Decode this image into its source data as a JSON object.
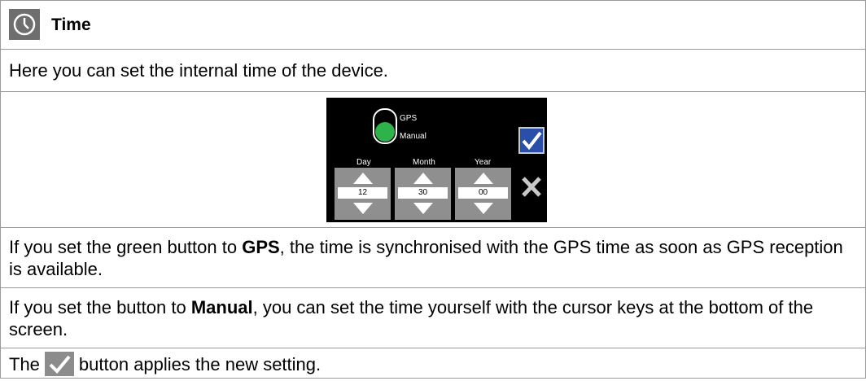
{
  "section": {
    "title": "Time",
    "icon": "clock-icon"
  },
  "intro": "Here you can set the internal time of the device.",
  "device": {
    "toggle_options": [
      "GPS",
      "Manual"
    ],
    "selected": "Manual",
    "fields": [
      {
        "label": "Day",
        "value": "12"
      },
      {
        "label": "Month",
        "value": "30"
      },
      {
        "label": "Year",
        "value": "00"
      }
    ],
    "confirm_icon": "checkmark-icon",
    "cancel_icon": "close-icon",
    "colors": {
      "toggle": "#2db34a",
      "confirm": "#2a4fa8"
    }
  },
  "para_gps": {
    "before": "If you set the green button to ",
    "bold": "GPS",
    "after": ", the time is synchronised with the GPS time as soon as GPS reception is available."
  },
  "para_manual": {
    "before": "If you set the button to ",
    "bold": "Manual",
    "after": ", you can set the time yourself with the cursor keys at the bottom of the screen."
  },
  "para_apply": {
    "before": "The",
    "after": "button applies the new setting.",
    "icon": "checkmark-icon"
  }
}
